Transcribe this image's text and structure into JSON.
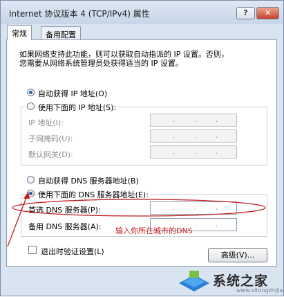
{
  "window": {
    "title": "Internet 协议版本 4 (TCP/IPv4) 属性",
    "help_label": "?",
    "close_label": "✕"
  },
  "tabs": [
    "常规",
    "备用配置"
  ],
  "intro": {
    "line1": "如果网络支持此功能，则可以获取自动指派的 IP 设置。否则，",
    "line2": "您需要从网络系统管理员处获得适当的 IP 设置。"
  },
  "ip_section": {
    "auto_label": "自动获得 IP 地址(O)",
    "manual_label": "使用下面的 IP 地址(S):",
    "fields": [
      {
        "label": "IP 地址(I):",
        "value": ". . ."
      },
      {
        "label": "子网掩码(U):",
        "value": ". . ."
      },
      {
        "label": "默认网关(D):",
        "value": ". . ."
      }
    ]
  },
  "dns_section": {
    "auto_label": "自动获得 DNS 服务器地址(B)",
    "manual_label": "使用下面的 DNS 服务器地址(E):",
    "fields": [
      {
        "label": "首选 DNS 服务器(P):",
        "value": ". . ."
      },
      {
        "label": "备用 DNS 服务器(A):",
        "value": ". . ."
      }
    ]
  },
  "annotation": "输入你所在城市的DNS",
  "validate_label": "退出时验证设置(L)",
  "advanced_label": "高级(V)...",
  "watermark": {
    "text": "系统之家",
    "url": "www.xitongzhijia.net"
  },
  "colors": {
    "annotation": "#c21b1b",
    "radio_selected": "#2d5fa0",
    "titlebar": "#c6d5e8"
  }
}
